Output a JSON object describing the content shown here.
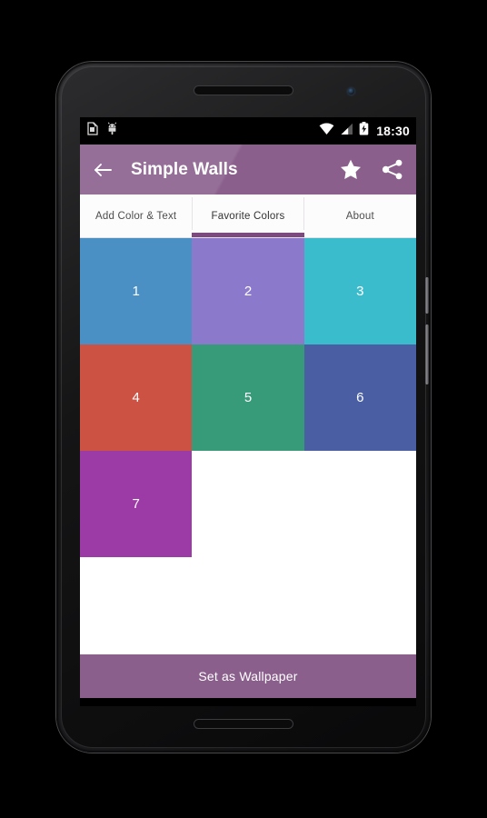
{
  "statusbar": {
    "notification_icons": [
      "sim-card-icon",
      "android-robot-icon"
    ],
    "wifi_icon": "wifi-icon",
    "signal_icon": "cellular-signal-icon",
    "battery_icon": "battery-charging-icon",
    "clock": "18:30"
  },
  "appbar": {
    "back_icon": "back-arrow-icon",
    "title": "Simple Walls",
    "favorite_icon": "star-icon",
    "share_icon": "share-icon",
    "background_color": "#8a5f8c"
  },
  "tabs": [
    {
      "label": "Add Color & Text",
      "selected": false
    },
    {
      "label": "Favorite Colors",
      "selected": true
    },
    {
      "label": "About",
      "selected": false
    }
  ],
  "tab_indicator_color": "#7d4a80",
  "swatches": [
    {
      "label": "1",
      "color": "#4a90c4"
    },
    {
      "label": "2",
      "color": "#8b79cc"
    },
    {
      "label": "3",
      "color": "#3bbccd"
    },
    {
      "label": "4",
      "color": "#cc5244"
    },
    {
      "label": "5",
      "color": "#379a79"
    },
    {
      "label": "6",
      "color": "#4a5fa3"
    },
    {
      "label": "7",
      "color": "#9c3ba5"
    }
  ],
  "wallpaper_button": {
    "label": "Set as Wallpaper",
    "background_color": "#8a5f8c"
  },
  "navbar": {
    "back": "nav-back-icon",
    "home": "nav-home-icon",
    "recents": "nav-recents-icon"
  }
}
